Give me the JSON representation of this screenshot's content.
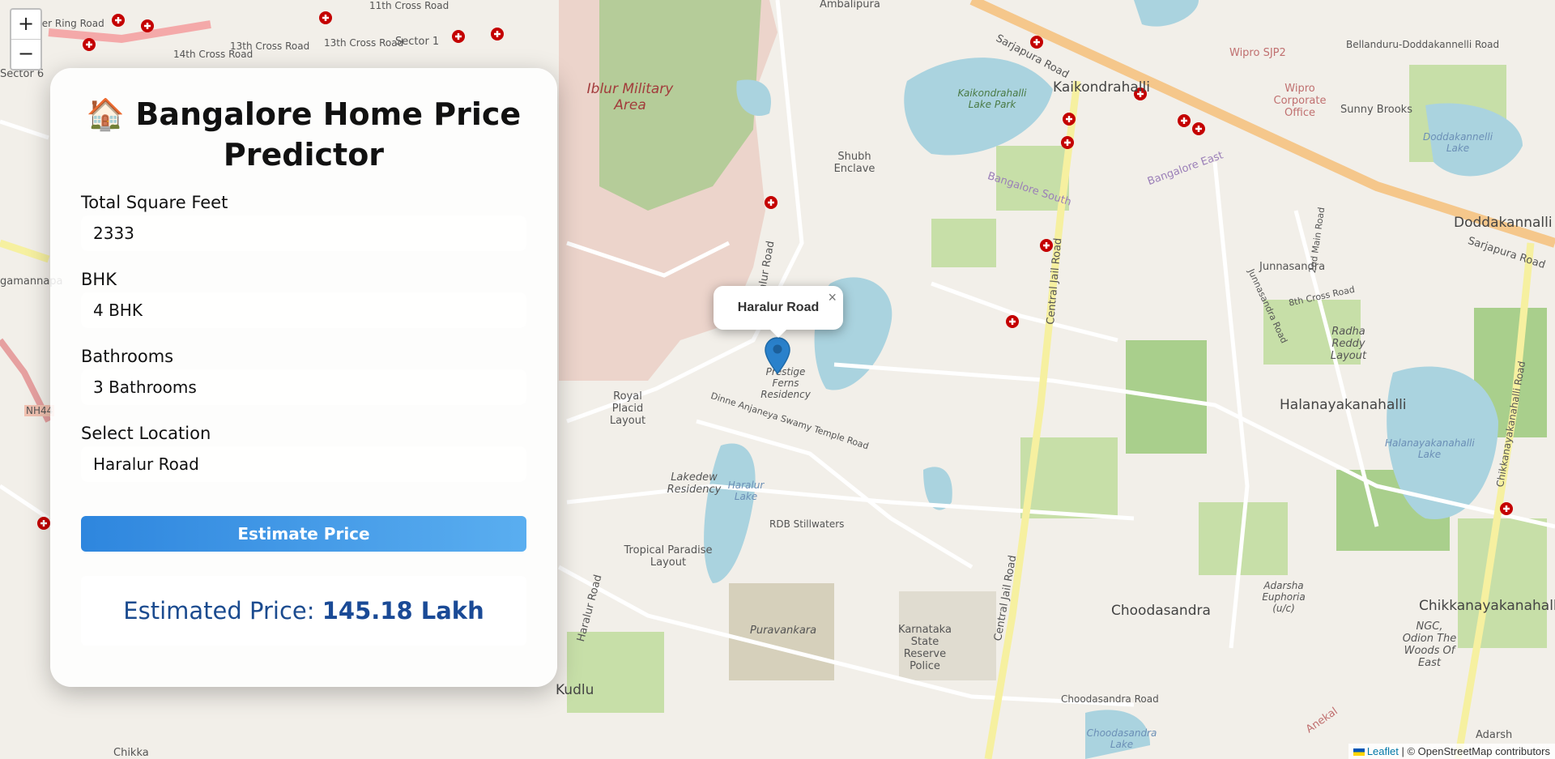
{
  "form": {
    "title_icon": "🏠",
    "title": "Bangalore Home Price Predictor",
    "sqft_label": "Total Square Feet",
    "sqft_value": "2333",
    "bhk_label": "BHK",
    "bhk_value": "4 BHK",
    "bath_label": "Bathrooms",
    "bath_value": "3 Bathrooms",
    "location_label": "Select Location",
    "location_value": "Haralur Road",
    "estimate_button": "Estimate Price",
    "result_prefix": "Estimated Price:",
    "result_value": "145.18 Lakh"
  },
  "map": {
    "zoom_in": "+",
    "zoom_out": "−",
    "popup_text": "Haralur Road",
    "popup_close": "×",
    "attribution_link": "Leaflet",
    "attribution_text": "| © OpenStreetMap contributors",
    "labels": {
      "ambalipura": "Ambalipura",
      "iblur": "Iblur Military Area",
      "kaikondrahalli": "Kaikondrahalli",
      "kaikondrahalli_lake": "Kaikondrahalli Lake Park",
      "wipro": "Wipro SJP2",
      "wipro_office": "Wipro Corporate Office",
      "sunny_brooks": "Sunny Brooks",
      "doddakannelli_lake": "Doddakannelli Lake",
      "doddakannalli": "Doddakannalli",
      "sarjapura_road": "Sarjapura Road",
      "bellandur": "Bellanduru-Doddakannelli Road",
      "shubh_enclave": "Shubh Enclave",
      "bangalore_south": "Bangalore South",
      "bangalore_east": "Bangalore East",
      "junnasandra": "Junnasandra",
      "radha_reddy": "Radha Reddy Layout",
      "halanayakanahalli": "Halanayakanahalli",
      "halanayakanahalli_lake": "Halanayakanahalli Lake",
      "chikkanayakanahalli": "Chikkanayakanahalli",
      "royal_placid": "Royal Placid Layout",
      "prestige": "Prestige Ferns Residency",
      "anjaneya": "Dinne Anjaneya Swamy Temple Road",
      "lakedew": "Lakedew Residency",
      "haralur_lake": "Haralur Lake",
      "rdb": "RDB Stillwaters",
      "tropical": "Tropical Paradise Layout",
      "puravankara": "Puravankara",
      "ksrp": "Karnataka State Reserve Police",
      "central_jail": "Central Jail Road",
      "choodasandra": "Choodasandra",
      "choodasandra_road": "Choodasandra Road",
      "choodasandra_lake": "Choodasandra Lake",
      "adarsha": "Adarsha Euphoria (u/c)",
      "ngc": "NGC, Odion The Woods Of East",
      "kudlu": "Kudlu",
      "haralur_road": "Haralur Road",
      "sector1": "Sector 1",
      "cross13": "13th Cross Road",
      "cross14": "14th Cross Road",
      "cross11": "11th Cross Road",
      "outer_ring": "Outer Ring Road",
      "sector6": "Sector 6",
      "nh44": "NH44",
      "gamannapalya": "gamannapa",
      "chikkanayakanahalli_road": "Chikkanayakanahalli Road",
      "adarsh": "Adarsh",
      "anekal": "Anekal",
      "cross8": "8th Cross Road",
      "main2": "2nd Main Road",
      "junnasandra_road": "Junnasandra Road",
      "chikka": "Chikka"
    }
  }
}
